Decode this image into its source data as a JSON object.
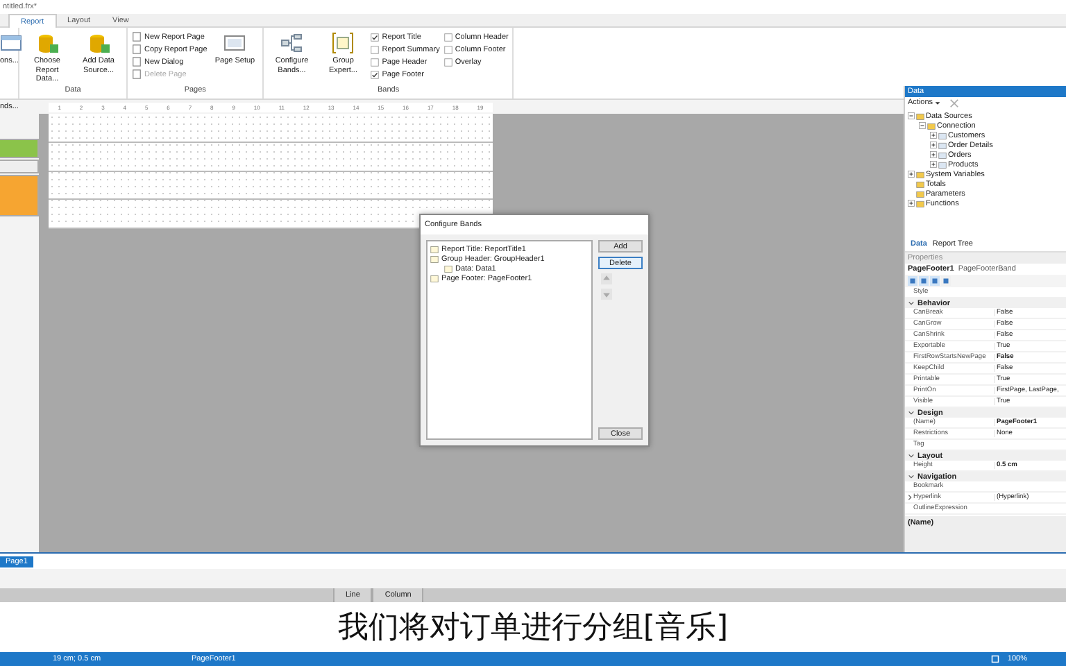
{
  "window": {
    "title": "ntitled.frx*"
  },
  "tabs": [
    {
      "label": "Report",
      "selected": true
    },
    {
      "label": "Layout",
      "selected": false
    },
    {
      "label": "View",
      "selected": false
    }
  ],
  "ribbon": {
    "cut_button": "ons...",
    "groups": [
      {
        "title": "Data",
        "items": [
          {
            "kind": "large",
            "label": "Choose Report Data..."
          },
          {
            "kind": "large",
            "label": "Add Data Source..."
          }
        ]
      },
      {
        "title": "Pages",
        "items": [
          {
            "kind": "small",
            "label": "New Report Page",
            "disabled": false
          },
          {
            "kind": "small",
            "label": "Copy Report Page",
            "disabled": false
          },
          {
            "kind": "small",
            "label": "New Dialog",
            "disabled": false
          },
          {
            "kind": "small",
            "label": "Delete Page",
            "disabled": true
          },
          {
            "kind": "large",
            "label": "Page Setup"
          }
        ]
      },
      {
        "title": "Bands",
        "items": [
          {
            "kind": "large",
            "label": "Configure Bands..."
          },
          {
            "kind": "large",
            "label": "Group Expert..."
          },
          {
            "kind": "check",
            "label": "Report Title",
            "checked": true
          },
          {
            "kind": "check",
            "label": "Report Summary",
            "checked": false
          },
          {
            "kind": "check",
            "label": "Page Header",
            "checked": false
          },
          {
            "kind": "check",
            "label": "Page Footer",
            "checked": true
          },
          {
            "kind": "check",
            "label": "Column Header",
            "checked": false
          },
          {
            "kind": "check",
            "label": "Column Footer",
            "checked": false
          },
          {
            "kind": "check",
            "label": "Overlay",
            "checked": false
          }
        ]
      }
    ]
  },
  "ruler": {
    "cut_label": "nds...",
    "numbers": [
      "1",
      "2",
      "3",
      "4",
      "5",
      "6",
      "7",
      "8",
      "9",
      "10",
      "11",
      "12",
      "13",
      "14",
      "15",
      "16",
      "17",
      "18",
      "19"
    ]
  },
  "dialog": {
    "title": "Configure Bands",
    "bands": [
      {
        "label": "Report Title: ReportTitle1"
      },
      {
        "label": "Group Header: GroupHeader1",
        "children": [
          {
            "label": "Data: Data1"
          }
        ]
      },
      {
        "label": "Page Footer: PageFooter1"
      }
    ],
    "buttons": [
      {
        "label": "Add",
        "focused": false
      },
      {
        "label": "Delete",
        "focused": true
      }
    ],
    "close": "Close"
  },
  "data_panel": {
    "title": "Data",
    "actions": "Actions",
    "tree": [
      {
        "label": "Data Sources",
        "expanded": true,
        "children": [
          {
            "label": "Connection",
            "expanded": true,
            "children": [
              {
                "label": "Customers",
                "expanded": false
              },
              {
                "label": "Order Details",
                "expanded": false
              },
              {
                "label": "Orders",
                "expanded": false
              },
              {
                "label": "Products",
                "expanded": false
              }
            ]
          }
        ]
      },
      {
        "label": "System Variables",
        "expanded": false
      },
      {
        "label": "Totals"
      },
      {
        "label": "Parameters"
      },
      {
        "label": "Functions",
        "expanded": false
      }
    ],
    "tabs": [
      {
        "label": "Data",
        "selected": true
      },
      {
        "label": "Report Tree",
        "selected": false
      }
    ]
  },
  "properties": {
    "title": "Properties",
    "object": "PageFooter1",
    "type": "PageFooterBand",
    "rows": [
      {
        "kind": "prop",
        "name": "Style"
      },
      {
        "kind": "category",
        "name": "Behavior"
      },
      {
        "kind": "prop",
        "name": "CanBreak",
        "value": "False",
        "bold": false
      },
      {
        "kind": "prop",
        "name": "CanGrow",
        "value": "False",
        "bold": false
      },
      {
        "kind": "prop",
        "name": "CanShrink",
        "value": "False",
        "bold": false
      },
      {
        "kind": "prop",
        "name": "Exportable",
        "value": "True",
        "bold": false
      },
      {
        "kind": "prop",
        "name": "FirstRowStartsNewPage",
        "value": "False",
        "bold": true
      },
      {
        "kind": "prop",
        "name": "KeepChild",
        "value": "False",
        "bold": false
      },
      {
        "kind": "prop",
        "name": "Printable",
        "value": "True",
        "bold": false
      },
      {
        "kind": "prop",
        "name": "PrintOn",
        "value": "FirstPage, LastPage,",
        "bold": false
      },
      {
        "kind": "prop",
        "name": "Visible",
        "value": "True",
        "bold": false
      },
      {
        "kind": "category",
        "name": "Design"
      },
      {
        "kind": "prop",
        "name": "(Name)",
        "value": "PageFooter1",
        "bold": true
      },
      {
        "kind": "prop",
        "name": "Restrictions",
        "value": "None",
        "bold": false
      },
      {
        "kind": "prop",
        "name": "Tag"
      },
      {
        "kind": "category",
        "name": "Layout"
      },
      {
        "kind": "prop",
        "name": "Height",
        "value": "0.5 cm",
        "bold": true
      },
      {
        "kind": "category",
        "name": "Navigation"
      },
      {
        "kind": "prop",
        "name": "Bookmark"
      },
      {
        "kind": "expandable",
        "name": "Hyperlink",
        "value": "(Hyperlink)",
        "bold": false
      },
      {
        "kind": "prop",
        "name": "OutlineExpression"
      }
    ],
    "description": "(Name)"
  },
  "page_tabs": [
    {
      "label": "Page1",
      "selected": true
    }
  ],
  "bottom_tabs": [
    "Line",
    "Column"
  ],
  "subtitle": "我们将对订单进行分组[音乐]",
  "status_bar": {
    "position": "19 cm; 0.5 cm",
    "object": "PageFooter1",
    "zoom": "100%"
  }
}
